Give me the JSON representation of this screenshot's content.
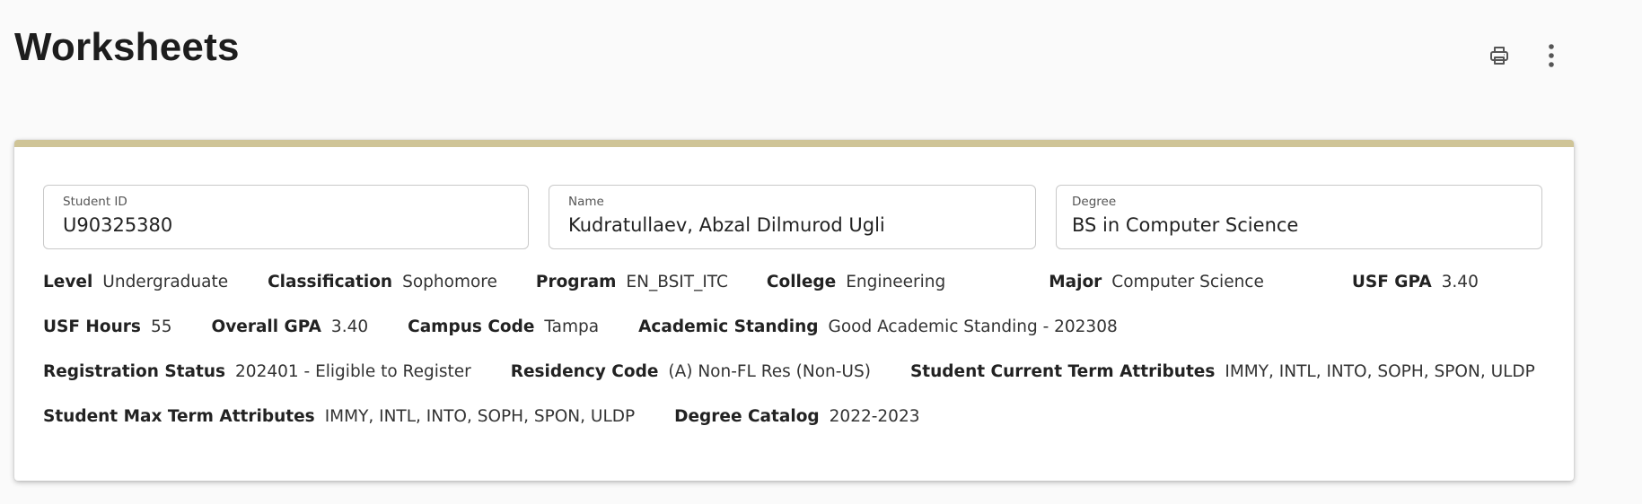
{
  "page": {
    "title": "Worksheets"
  },
  "header_actions": {
    "print_icon": "printer-icon",
    "more_icon": "more-vertical-icon"
  },
  "colors": {
    "card_accent": "#cfc497",
    "field_border": "#c9c9c9",
    "background": "#fafafa"
  },
  "fields": {
    "student_id": {
      "label": "Student ID",
      "value": "U90325380"
    },
    "name": {
      "label": "Name",
      "value": "Kudratullaev, Abzal Dilmurod Ugli"
    },
    "degree": {
      "label": "Degree",
      "value": "BS in Computer Science"
    }
  },
  "attributes": [
    [
      {
        "label": "Level",
        "value": "Undergraduate"
      },
      {
        "label": "Classification",
        "value": "Sophomore"
      },
      {
        "label": "Program",
        "value": "EN_BSIT_ITC"
      },
      {
        "label": "College",
        "value": "Engineering"
      },
      {
        "label": "Major",
        "value": "Computer Science"
      },
      {
        "label": "USF GPA",
        "value": "3.40"
      }
    ],
    [
      {
        "label": "USF Hours",
        "value": "55"
      },
      {
        "label": "Overall GPA",
        "value": "3.40"
      },
      {
        "label": "Campus Code",
        "value": "Tampa"
      },
      {
        "label": "Academic Standing",
        "value": "Good Academic Standing - 202308"
      }
    ],
    [
      {
        "label": "Registration Status",
        "value": "202401 - Eligible to Register"
      },
      {
        "label": "Residency Code",
        "value": "(A) Non-FL Res (Non-US)"
      },
      {
        "label": "Student Current Term Attributes",
        "value": "IMMY, INTL, INTO, SOPH, SPON, ULDP"
      }
    ],
    [
      {
        "label": "Student Max Term Attributes",
        "value": "IMMY, INTL, INTO, SOPH, SPON, ULDP"
      },
      {
        "label": "Degree Catalog",
        "value": "2022-2023"
      }
    ]
  ]
}
